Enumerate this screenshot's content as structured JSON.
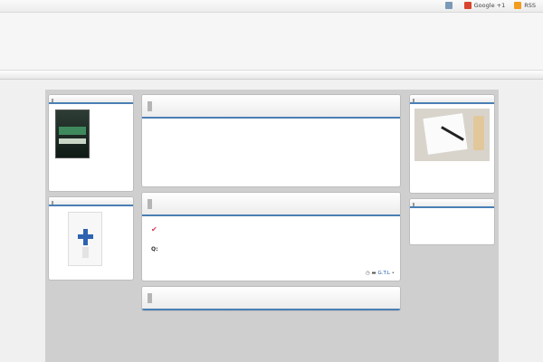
{
  "topbar": {
    "links": [
      {
        "label": "",
        "icon": "home-icon"
      },
      {
        "label": "Google +1",
        "icon": "google-plus-icon"
      },
      {
        "label": "RSS",
        "icon": "rss-icon"
      }
    ]
  },
  "header": {
    "title": "",
    "description": ""
  },
  "left": {
    "widget1": {
      "title": "",
      "book_link": "",
      "desc": "",
      "more": ""
    },
    "widget2": {
      "title": "",
      "book_link_1": "",
      "book_link_2": "",
      "desc": ""
    }
  },
  "main": {
    "menu": {
      "title": "",
      "lines": [
        "",
        "",
        "",
        "",
        "",
        ""
      ]
    },
    "post": {
      "title": "",
      "check_line": "",
      "question": "Q:",
      "read_more": "",
      "meta_date": "",
      "meta_category": "G.T.L",
      "meta_comments": ""
    },
    "post2": {
      "title": ""
    }
  },
  "right": {
    "widget1": {
      "title": "",
      "link": "",
      "desc": "",
      "more": ""
    },
    "widget2": {
      "title": ""
    }
  },
  "colors": {
    "accent": "#4a7fb5",
    "link": "#1e5fae",
    "heart": "#d43a5a"
  }
}
